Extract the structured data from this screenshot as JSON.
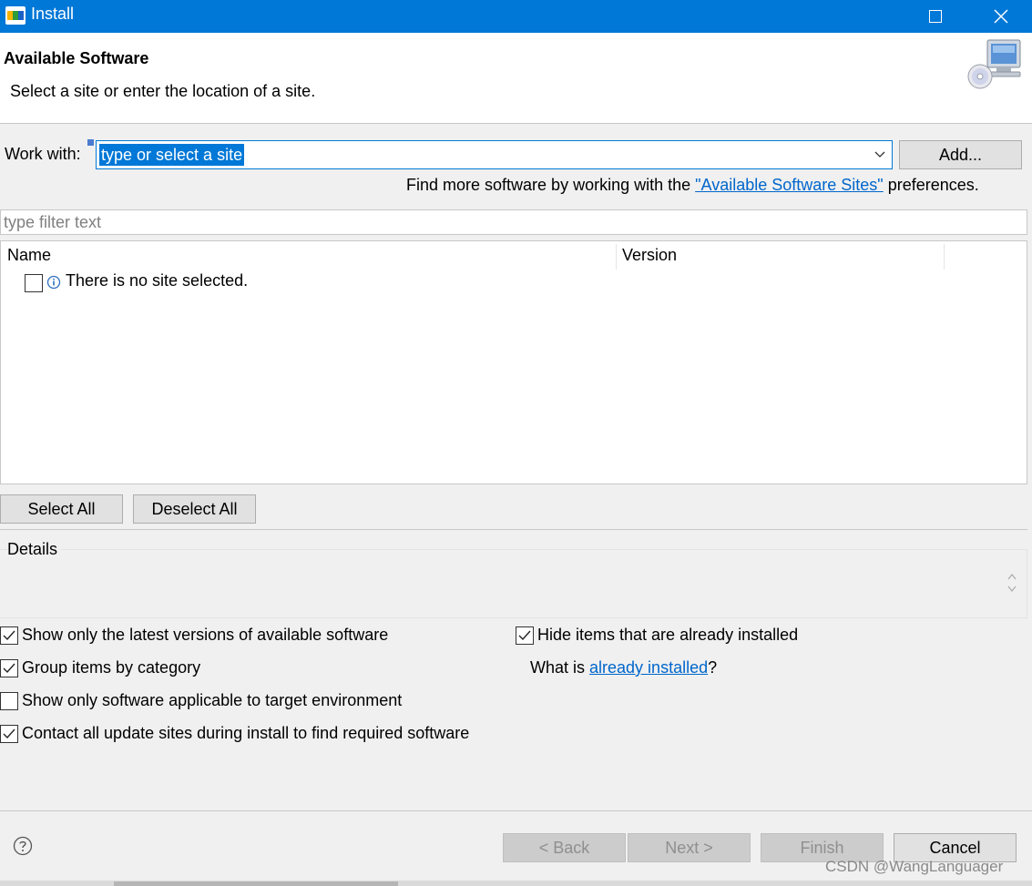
{
  "window": {
    "title": "Install",
    "app_icon": "nxp-logo-icon"
  },
  "header": {
    "title": "Available Software",
    "description": "Select a site or enter the location of a site.",
    "banner_icon": "install-cd-monitor-icon"
  },
  "work_with": {
    "label": "Work with:",
    "value": "type or select a site",
    "add_label": "Add..."
  },
  "find_more": {
    "prefix": "Find more software by working with the ",
    "link": "\"Available Software Sites\"",
    "suffix": " preferences."
  },
  "filter": {
    "placeholder": "type filter text"
  },
  "tree": {
    "columns": [
      "Name",
      "Version"
    ],
    "rows": [
      {
        "text": "There is no site selected.",
        "checked": false,
        "icon": "info-icon"
      }
    ]
  },
  "selection_buttons": {
    "select_all": "Select All",
    "deselect_all": "Deselect All"
  },
  "details": {
    "label": "Details"
  },
  "options": [
    {
      "label": "Show only the latest versions of available software",
      "checked": true
    },
    {
      "label": "Group items by category",
      "checked": true
    },
    {
      "label": "Show only software applicable to target environment",
      "checked": false
    },
    {
      "label": "Contact all update sites during install to find required software",
      "checked": true
    },
    {
      "label": "Hide items that are already installed",
      "checked": true
    }
  ],
  "already_installed": {
    "prefix": "What is ",
    "link": "already installed",
    "suffix": "?"
  },
  "footer": {
    "back": "< Back",
    "next": "Next >",
    "finish": "Finish",
    "cancel": "Cancel",
    "watermark": "CSDN @WangLanguager"
  },
  "colors": {
    "titlebar": "#0078d7",
    "link": "#0066cc"
  }
}
